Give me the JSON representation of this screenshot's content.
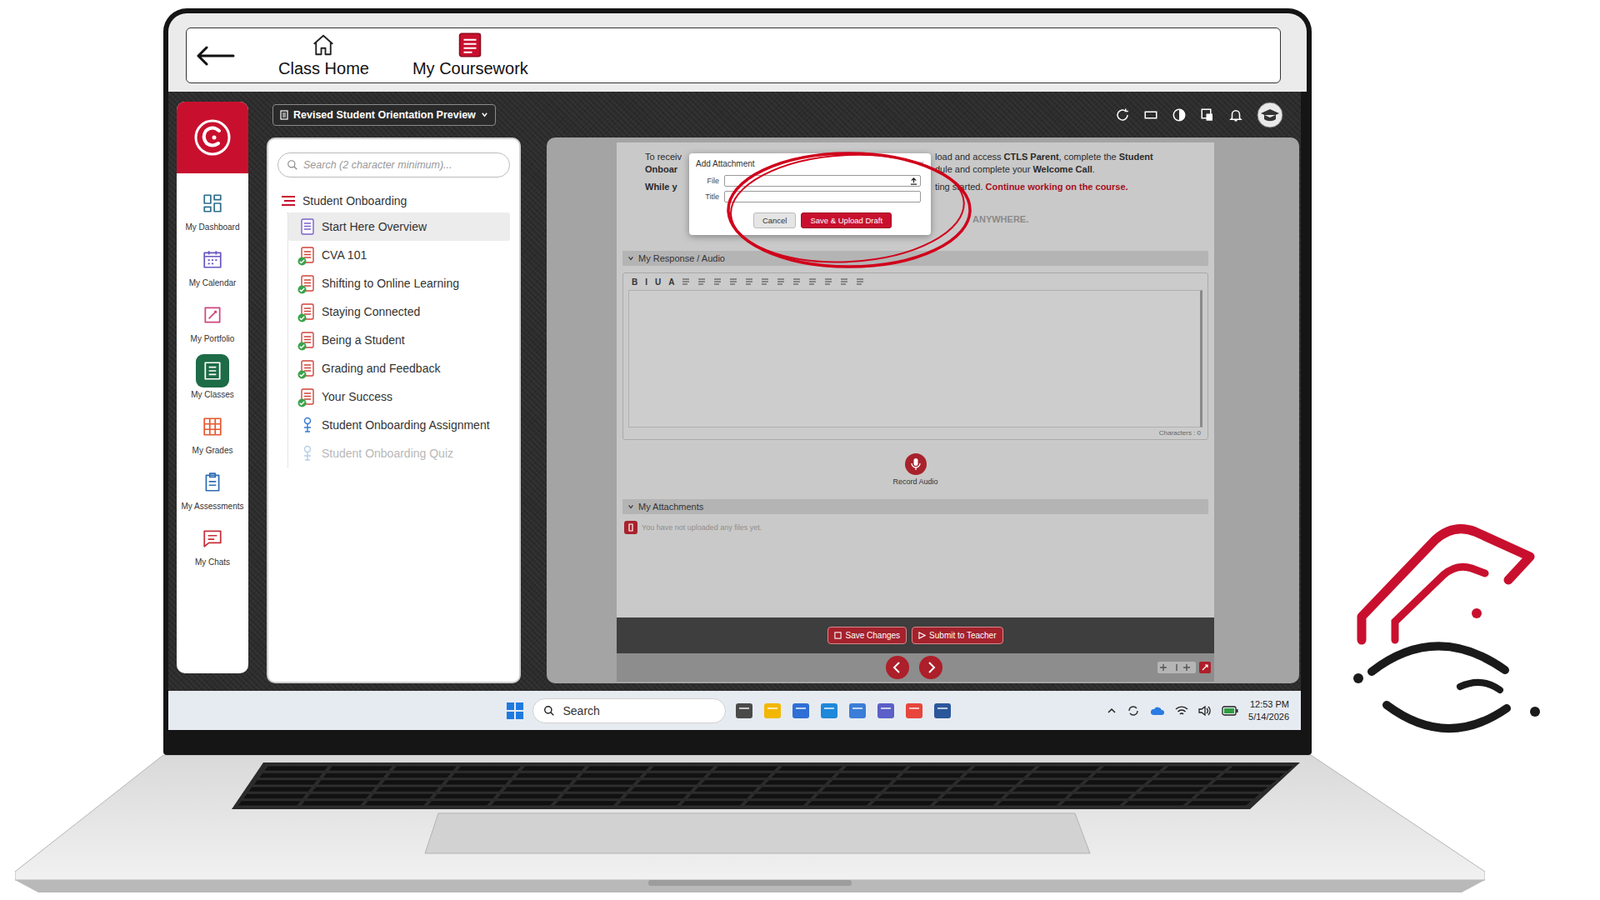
{
  "top_bar": {
    "tabs": [
      {
        "label": "Class Home",
        "selected": false
      },
      {
        "label": "My Coursework",
        "selected": true
      }
    ]
  },
  "header": {
    "course": "Revised Student Orientation Preview"
  },
  "dock": {
    "items": [
      {
        "label": "My Dashboard",
        "selected": false,
        "color": "#2d6e8e"
      },
      {
        "label": "My Calendar",
        "selected": false,
        "color": "#6a55c2"
      },
      {
        "label": "My Portfolio",
        "selected": false,
        "color": "#d0457f"
      },
      {
        "label": "My Classes",
        "selected": true,
        "color": "#1e6b47"
      },
      {
        "label": "My Grades",
        "selected": false,
        "color": "#e4572e"
      },
      {
        "label": "My Assessments",
        "selected": false,
        "color": "#2e6db4"
      },
      {
        "label": "My Chats",
        "selected": false,
        "color": "#c62f3a"
      }
    ]
  },
  "tree": {
    "search_placeholder": "Search (2 character minimum)...",
    "title": "Student Onboarding",
    "items": [
      {
        "label": "Start Here Overview",
        "kind": "page",
        "completed": false,
        "selected": true,
        "disabled": false
      },
      {
        "label": "CVA 101",
        "kind": "lesson",
        "completed": true,
        "selected": false,
        "disabled": false
      },
      {
        "label": "Shifting to Online Learning",
        "kind": "lesson",
        "completed": true,
        "selected": false,
        "disabled": false
      },
      {
        "label": "Staying Connected",
        "kind": "lesson",
        "completed": true,
        "selected": false,
        "disabled": false
      },
      {
        "label": "Being a Student",
        "kind": "lesson",
        "completed": true,
        "selected": false,
        "disabled": false
      },
      {
        "label": "Grading and Feedback",
        "kind": "lesson",
        "completed": true,
        "selected": false,
        "disabled": false
      },
      {
        "label": "Your Success",
        "kind": "lesson",
        "completed": true,
        "selected": false,
        "disabled": false
      },
      {
        "label": "Student Onboarding Assignment",
        "kind": "assignment",
        "completed": false,
        "selected": false,
        "disabled": false
      },
      {
        "label": "Student Onboarding Quiz",
        "kind": "quiz",
        "completed": false,
        "selected": false,
        "disabled": true
      }
    ]
  },
  "content": {
    "intro_lines": [
      {
        "left": [
          {
            "text": "To receiv",
            "bold": false,
            "red": false
          }
        ],
        "right": [
          {
            "text": "load and access ",
            "bold": false,
            "red": false
          },
          {
            "text": "CTLS Parent",
            "bold": true,
            "red": false
          },
          {
            "text": ", complete the ",
            "bold": false,
            "red": false
          },
          {
            "text": "Student",
            "bold": true,
            "red": false
          }
        ]
      },
      {
        "left": [
          {
            "text": "Onboar",
            "bold": true,
            "red": false
          }
        ],
        "right": [
          {
            "text": "dule and complete your ",
            "bold": false,
            "red": false
          },
          {
            "text": "Welcome Call",
            "bold": true,
            "red": false
          },
          {
            "text": ".",
            "bold": false,
            "red": false
          }
        ]
      },
      {
        "left": [
          {
            "text": "While y",
            "bold": true,
            "red": false
          }
        ],
        "right": [
          {
            "text": "ting started. ",
            "bold": false,
            "red": false
          },
          {
            "text": "Continue working on the course.",
            "bold": true,
            "red": true
          }
        ]
      }
    ],
    "faded_line": "ANYWHERE.",
    "response_section": "My Response / Audio",
    "toolbar": [
      "B",
      "I",
      "U",
      "A"
    ],
    "characters": "Characters : 0",
    "record_label": "Record Audio",
    "attachments_section": "My Attachments",
    "attachments_empty": "You have not uploaded any files yet.",
    "footer_buttons": [
      "Save Changes",
      "Submit to Teacher"
    ]
  },
  "dialog": {
    "title": "Add Attachment",
    "close": "×",
    "highlighted": true,
    "fields": [
      {
        "label": "File",
        "kind": "file"
      },
      {
        "label": "Title",
        "kind": "text"
      }
    ],
    "buttons": [
      {
        "label": "Cancel",
        "primary": false
      },
      {
        "label": "Save & Upload Draft",
        "primary": true
      }
    ]
  },
  "taskbar": {
    "search": "Search",
    "time": "12:53 PM",
    "date": "5/14/2026"
  }
}
